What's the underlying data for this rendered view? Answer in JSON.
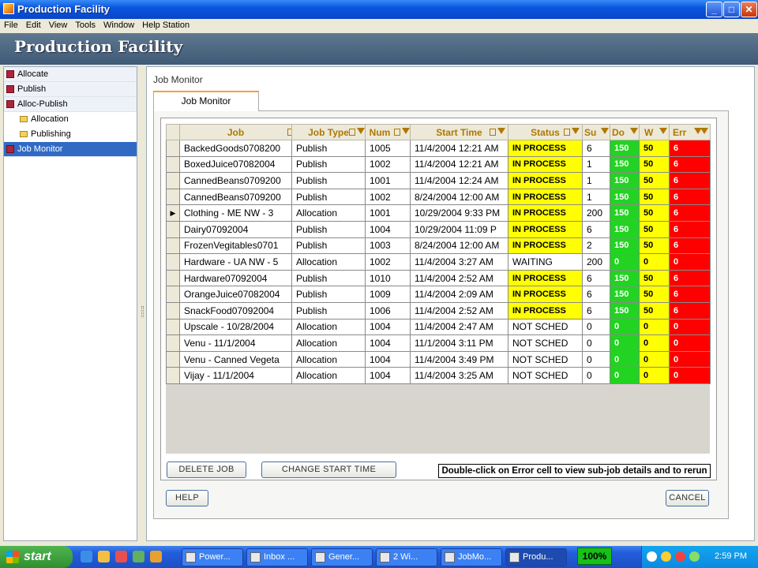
{
  "window": {
    "title": "Production Facility"
  },
  "menu": [
    "File",
    "Edit",
    "View",
    "Tools",
    "Window",
    "Help Station"
  ],
  "banner": {
    "title": "Production Facility"
  },
  "sidebar": {
    "items": [
      {
        "label": "Allocate"
      },
      {
        "label": "Publish"
      },
      {
        "label": "Alloc-Publish"
      },
      {
        "label": "Allocation"
      },
      {
        "label": "Publishing"
      },
      {
        "label": "Job Monitor"
      }
    ]
  },
  "main": {
    "section_title": "Job Monitor",
    "tab_label": "Job Monitor"
  },
  "grid": {
    "columns": [
      "Job",
      "Job Type",
      "Num",
      "Start Time",
      "Status",
      "Su",
      "Do",
      "W",
      "Err"
    ],
    "rows": [
      {
        "job": "BackedGoods0708200",
        "type": "Publish",
        "num": "1005",
        "start": "11/4/2004 12:21 AM",
        "status": "IN PROCESS",
        "su": "6",
        "do": "150",
        "w": "50",
        "err": "6"
      },
      {
        "job": "BoxedJuice07082004",
        "type": "Publish",
        "num": "1002",
        "start": "11/4/2004 12:21 AM",
        "status": "IN PROCESS",
        "su": "1",
        "do": "150",
        "w": "50",
        "err": "6"
      },
      {
        "job": "CannedBeans0709200",
        "type": "Publish",
        "num": "1001",
        "start": "11/4/2004 12:24 AM",
        "status": "IN PROCESS",
        "su": "1",
        "do": "150",
        "w": "50",
        "err": "6"
      },
      {
        "job": "CannedBeans0709200",
        "type": "Publish",
        "num": "1002",
        "start": "8/24/2004 12:00 AM",
        "status": "IN PROCESS",
        "su": "1",
        "do": "150",
        "w": "50",
        "err": "6"
      },
      {
        "job": "Clothing - ME NW - 3",
        "type": "Allocation",
        "num": "1001",
        "start": "10/29/2004 9:33 PM",
        "status": "IN PROCESS",
        "su": "200",
        "do": "150",
        "w": "50",
        "err": "6"
      },
      {
        "job": "Dairy07092004",
        "type": "Publish",
        "num": "1004",
        "start": "10/29/2004 11:09 P",
        "status": "IN PROCESS",
        "su": "6",
        "do": "150",
        "w": "50",
        "err": "6"
      },
      {
        "job": "FrozenVegitables0701",
        "type": "Publish",
        "num": "1003",
        "start": "8/24/2004 12:00 AM",
        "status": "IN PROCESS",
        "su": "2",
        "do": "150",
        "w": "50",
        "err": "6"
      },
      {
        "job": "Hardware - UA NW - 5",
        "type": "Allocation",
        "num": "1002",
        "start": "11/4/2004 3:27 AM",
        "status": "WAITING",
        "su": "200",
        "do": "0",
        "w": "0",
        "err": "0"
      },
      {
        "job": "Hardware07092004",
        "type": "Publish",
        "num": "1010",
        "start": "11/4/2004 2:52 AM",
        "status": "IN PROCESS",
        "su": "6",
        "do": "150",
        "w": "50",
        "err": "6"
      },
      {
        "job": "OrangeJuice07082004",
        "type": "Publish",
        "num": "1009",
        "start": "11/4/2004 2:09 AM",
        "status": "IN PROCESS",
        "su": "6",
        "do": "150",
        "w": "50",
        "err": "6"
      },
      {
        "job": "SnackFood07092004",
        "type": "Publish",
        "num": "1006",
        "start": "11/4/2004 2:52 AM",
        "status": "IN PROCESS",
        "su": "6",
        "do": "150",
        "w": "50",
        "err": "6"
      },
      {
        "job": "Upscale  - 10/28/2004",
        "type": "Allocation",
        "num": "1004",
        "start": "11/4/2004 2:47 AM",
        "status": "NOT SCHED",
        "su": "0",
        "do": "0",
        "w": "0",
        "err": "0"
      },
      {
        "job": "Venu - 11/1/2004",
        "type": "Allocation",
        "num": "1004",
        "start": "11/1/2004 3:11 PM",
        "status": "NOT SCHED",
        "su": "0",
        "do": "0",
        "w": "0",
        "err": "0"
      },
      {
        "job": "Venu - Canned Vegeta",
        "type": "Allocation",
        "num": "1004",
        "start": "11/4/2004 3:49 PM",
        "status": "NOT SCHED",
        "su": "0",
        "do": "0",
        "w": "0",
        "err": "0"
      },
      {
        "job": "Vijay  - 11/1/2004",
        "type": "Allocation",
        "num": "1004",
        "start": "11/4/2004 3:25 AM",
        "status": "NOT SCHED",
        "su": "0",
        "do": "0",
        "w": "0",
        "err": "0"
      }
    ],
    "current_row_marker": "▶"
  },
  "buttons": {
    "delete_job": "DELETE JOB",
    "change_start": "CHANGE START TIME",
    "help": "HELP",
    "cancel": "CANCEL"
  },
  "hint": "Double-click on Error cell to view sub-job details and to rerun",
  "taskbar": {
    "start": "start",
    "tasks": [
      "Power...",
      "Inbox ...",
      "Gener...",
      "2 Wi...",
      "JobMo...",
      "Produ..."
    ],
    "zoom": "100%",
    "clock": "2:59 PM"
  },
  "colors": {
    "in_process": "#ffff00",
    "done": "#22d322",
    "warn": "#ffff00",
    "error": "#ff0000",
    "selected": "#316ac5"
  }
}
